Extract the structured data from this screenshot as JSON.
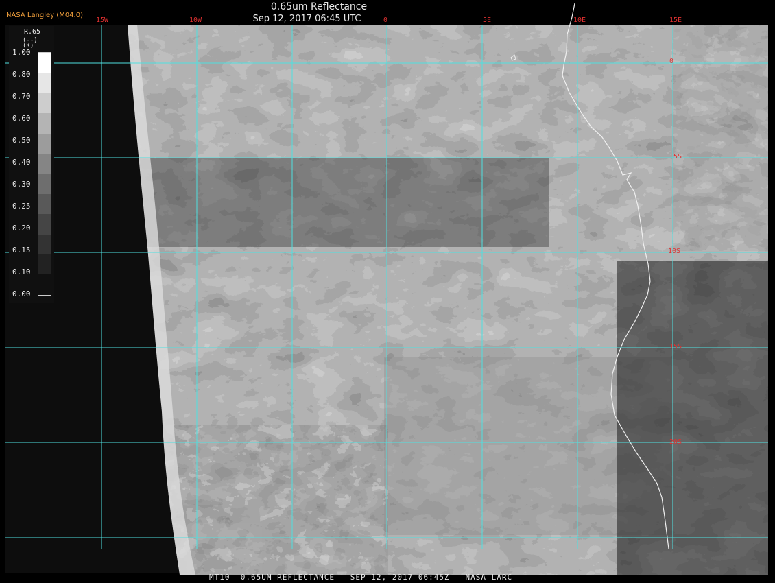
{
  "header": {
    "title": "0.65um Reflectance",
    "datetime": "Sep 12, 2017 06:45 UTC",
    "producer": "NASA Langley (M04.0)"
  },
  "footer": {
    "caption": "MT10  0.65UM REFLECTANCE   SEP 12, 2017 06:45Z   NASA LARC"
  },
  "legend": {
    "name": "R.65",
    "unit": "(--)",
    "k_label": "(K)",
    "ticks": [
      "1.00",
      "0.80",
      "0.70",
      "0.60",
      "0.50",
      "0.40",
      "0.30",
      "0.25",
      "0.20",
      "0.15",
      "0.10",
      "0.00"
    ],
    "colors": [
      "#ffffff",
      "#e6e6e6",
      "#cdcdcd",
      "#b4b4b4",
      "#9c9c9c",
      "#858585",
      "#6e6e6e",
      "#595959",
      "#454545",
      "#333333",
      "#222222",
      "#101010"
    ]
  },
  "grid": {
    "color": "#4fe0e0",
    "lon_labels": [
      "15W",
      "10W",
      "0",
      "5E",
      "10E",
      "15E"
    ],
    "lat_labels": [
      "0",
      "5S",
      "10S",
      "15S",
      "20S"
    ]
  },
  "coastline_color": "#f0f0f0"
}
